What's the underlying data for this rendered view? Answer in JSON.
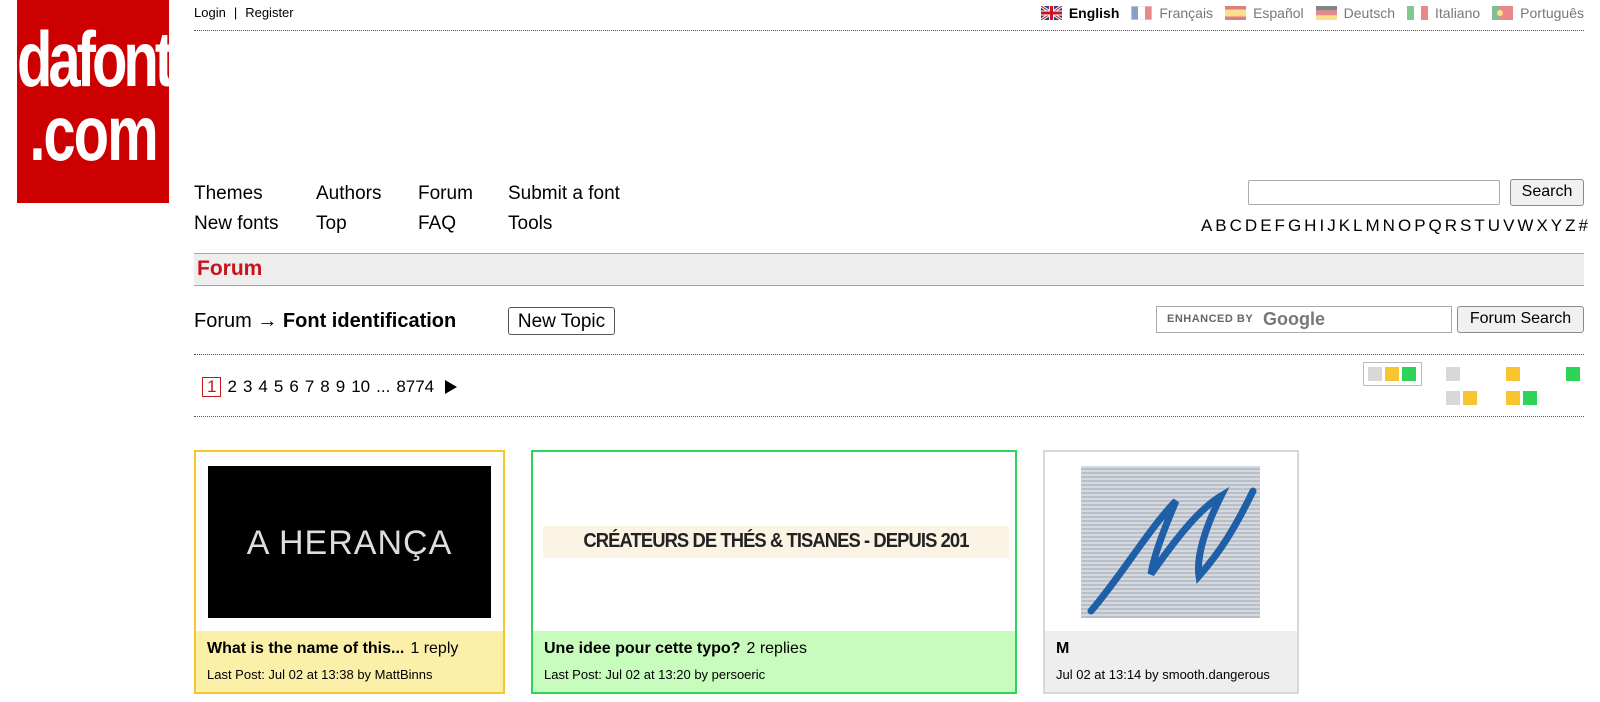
{
  "logo": {
    "line1": "dafont",
    "line2": ".com"
  },
  "top_links": {
    "login": "Login",
    "separator": "|",
    "register": "Register"
  },
  "languages": [
    {
      "label": "English",
      "icon": "flag-uk-icon",
      "active": true
    },
    {
      "label": "Français",
      "icon": "flag-france-icon",
      "active": false
    },
    {
      "label": "Español",
      "icon": "flag-spain-icon",
      "active": false
    },
    {
      "label": "Deutsch",
      "icon": "flag-germany-icon",
      "active": false
    },
    {
      "label": "Italiano",
      "icon": "flag-italy-icon",
      "active": false
    },
    {
      "label": "Português",
      "icon": "flag-portugal-icon",
      "active": false
    }
  ],
  "nav": {
    "themes": "Themes",
    "authors": "Authors",
    "forum": "Forum",
    "submit": "Submit a font",
    "new_fonts": "New fonts",
    "top": "Top",
    "faq": "FAQ",
    "tools": "Tools"
  },
  "search": {
    "value": "",
    "button": "Search"
  },
  "alphabet": [
    "A",
    "B",
    "C",
    "D",
    "E",
    "F",
    "G",
    "H",
    "I",
    "J",
    "K",
    "L",
    "M",
    "N",
    "O",
    "P",
    "Q",
    "R",
    "S",
    "T",
    "U",
    "V",
    "W",
    "X",
    "Y",
    "Z",
    "#"
  ],
  "section_title": "Forum",
  "breadcrumb": {
    "root": "Forum",
    "arrow": "→",
    "current": "Font identification"
  },
  "new_topic": "New Topic",
  "google_search": {
    "enhanced_by": "ENHANCED BY",
    "google": "Google",
    "button": "Forum Search"
  },
  "pagination": {
    "current": "1",
    "pages": [
      "2",
      "3",
      "4",
      "5",
      "6",
      "7",
      "8",
      "9",
      "10"
    ],
    "ellipsis": "...",
    "last": "8774",
    "next_icon": "next-arrow-icon"
  },
  "colors": {
    "brand_red": "#cc0000",
    "title_red": "#c8141c",
    "yellow": "#f8c531",
    "green": "#2ed45a",
    "gray": "#d8d8d8"
  },
  "topics": [
    {
      "status": "yellow",
      "image_text": "A HERANÇA",
      "title": "What is the name of this...",
      "replies": "1 reply",
      "meta": "Last Post: Jul 02 at 13:38 by MattBinns"
    },
    {
      "status": "green",
      "image_text": "CRÉATEURS DE THÉS & TISANES - DEPUIS 201",
      "title": "Une idee pour cette typo?",
      "replies": "2 replies",
      "meta": "Last Post: Jul 02 at 13:20 by persoeric"
    },
    {
      "status": "gray",
      "image_text": "M",
      "title": "M",
      "replies": "",
      "meta": "Jul 02 at 13:14 by smooth.dangerous"
    }
  ]
}
